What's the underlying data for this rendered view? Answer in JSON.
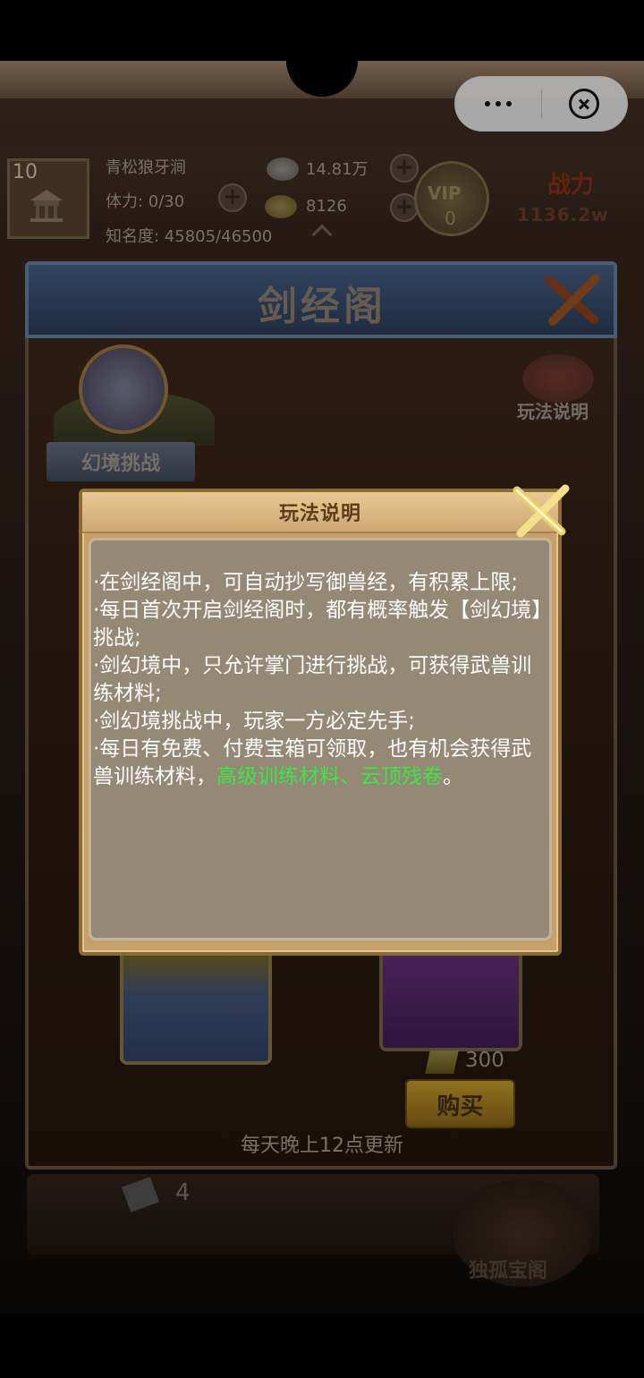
{
  "capsule": {
    "more_icon": "more-dots-icon",
    "close_icon": "circle-close-icon"
  },
  "player": {
    "level": "10",
    "name": "青松狼牙涧",
    "stamina": "体力: 0/30",
    "fame": "知名度: 45805/46500",
    "silver": "14.81万",
    "gold": "8126",
    "vip_label": "VIP",
    "vip_level": "0",
    "power_label": "战力",
    "power_value": "1136.2w"
  },
  "panel": {
    "title": "剑经阁",
    "challenge_label": "幻境挑战",
    "rules_label": "玩法说明",
    "price": "300",
    "buy_label": "购买",
    "refresh_note": "每天晚上12点更新",
    "ticket_count": "4",
    "treasure_label": "独孤宝阁"
  },
  "modal": {
    "title": "玩法说明",
    "rule1": "·在剑经阁中，可自动抄写御兽经，有积累上限;",
    "rule2": "·每日首次开启剑经阁时，都有概率触发【剑幻境】挑战;",
    "rule3": "·剑幻境中，只允许掌门进行挑战，可获得武兽训练材料;",
    "rule4": "·剑幻境挑战中，玩家一方必定先手;",
    "rule5_prefix": "·每日有免费、付费宝箱可领取，也有机会获得武兽训练材料，",
    "rule5_highlight": "高级训练材料、云顶残卷",
    "rule5_suffix": "。",
    "highlight_color": "#3be64a"
  }
}
